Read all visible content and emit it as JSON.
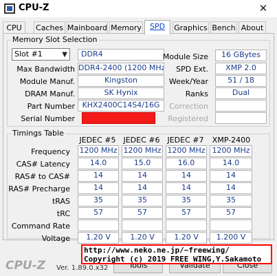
{
  "window": {
    "title": "CPU-Z",
    "close_glyph": "✕"
  },
  "tabs": [
    {
      "label": "CPU"
    },
    {
      "label": "Caches"
    },
    {
      "label": "Mainboard"
    },
    {
      "label": "Memory"
    },
    {
      "label": "SPD",
      "active": true
    },
    {
      "label": "Graphics"
    },
    {
      "label": "Bench"
    },
    {
      "label": "About"
    }
  ],
  "memory_slot_selection": {
    "title": "Memory Slot Selection",
    "slot_select": {
      "value": "Slot #1",
      "arrow": "▼"
    },
    "fields_left": [
      {
        "label": "",
        "value": "DDR4"
      },
      {
        "label": "Max Bandwidth",
        "value": "DDR4-2400 (1200 MHz)"
      },
      {
        "label": "Module Manuf.",
        "value": "Kingston"
      },
      {
        "label": "DRAM Manuf.",
        "value": "SK Hynix"
      },
      {
        "label": "Part Number",
        "value": "KHX2400C14S4/16G"
      },
      {
        "label": "Serial Number",
        "value": ""
      }
    ],
    "fields_right": [
      {
        "label": "Module Size",
        "value": "16 GBytes"
      },
      {
        "label": "SPD Ext.",
        "value": "XMP 2.0"
      },
      {
        "label": "Week/Year",
        "value": "51 / 18"
      },
      {
        "label": "Ranks",
        "value": "Dual"
      },
      {
        "label": "Correction",
        "value": ""
      },
      {
        "label": "Registered",
        "value": ""
      }
    ]
  },
  "timings": {
    "title": "Timings Table",
    "columns": [
      "JEDEC #5",
      "JEDEC #6",
      "JEDEC #7",
      "XMP-2400"
    ],
    "rows": [
      {
        "label": "Frequency",
        "values": [
          "1200 MHz",
          "1200 MHz",
          "1200 MHz",
          "1200 MHz"
        ]
      },
      {
        "label": "CAS# Latency",
        "values": [
          "14.0",
          "15.0",
          "16.0",
          "14.0"
        ]
      },
      {
        "label": "RAS# to CAS#",
        "values": [
          "14",
          "14",
          "14",
          "14"
        ]
      },
      {
        "label": "RAS# Precharge",
        "values": [
          "14",
          "14",
          "14",
          "14"
        ]
      },
      {
        "label": "tRAS",
        "values": [
          "35",
          "35",
          "35",
          "35"
        ]
      },
      {
        "label": "tRC",
        "values": [
          "57",
          "57",
          "57",
          "57"
        ]
      },
      {
        "label": "Command Rate",
        "values": [
          "",
          "",
          "",
          ""
        ]
      },
      {
        "label": "Voltage",
        "values": [
          "1.20 V",
          "1.20 V",
          "1.20 V",
          "1.200 V"
        ]
      }
    ]
  },
  "footer": {
    "logo": "CPU-Z",
    "version": "Ver. 1.89.0.x32",
    "tools_label": "Tools",
    "validate_label": "Validate",
    "close_label": "Close"
  },
  "watermark": {
    "line1": "http://www.neko.ne.jp/~freewing/",
    "line2": "Copyright (c) 2019 FREE WING,Y.Sakamoto"
  }
}
